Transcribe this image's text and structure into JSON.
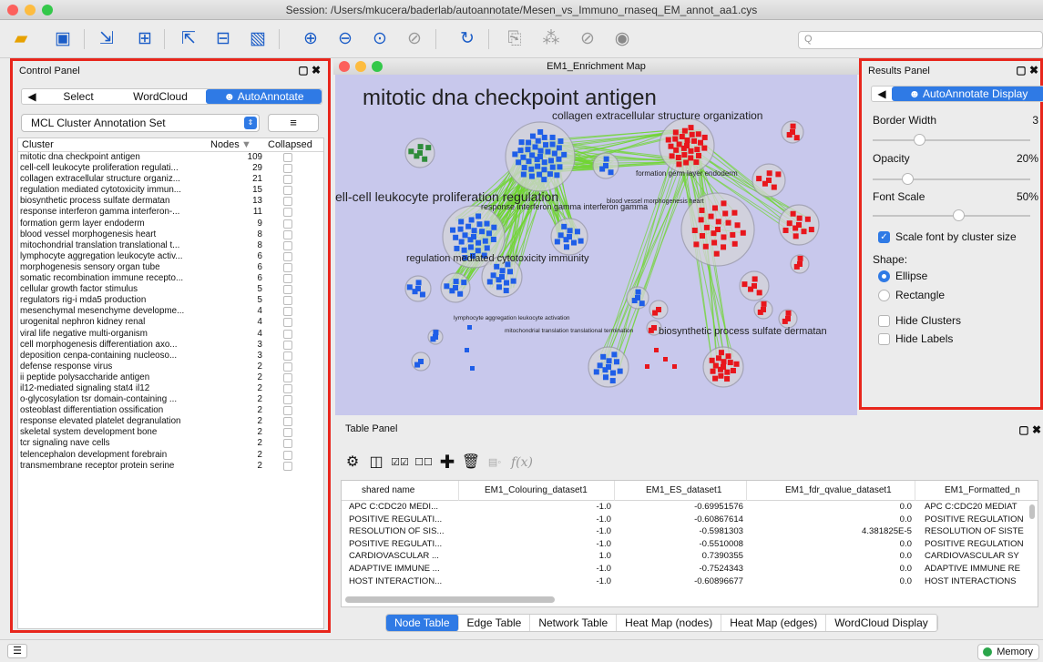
{
  "window": {
    "title": "Session: /Users/mkucera/baderlab/autoannotate/Mesen_vs_Immuno_rnaseq_EM_annot_aa1.cys"
  },
  "toolbar": {
    "search_placeholder": "Q",
    "icons": [
      "open-folder",
      "save",
      "import-network",
      "import-table",
      "export-network",
      "export-table",
      "export-image",
      "zoom-in",
      "zoom-out",
      "zoom-fit",
      "zoom-selected",
      "refresh",
      "new-network-from-selection",
      "hide",
      "show-hidden",
      "show"
    ]
  },
  "control_panel": {
    "title": "Control Panel",
    "tabs": [
      "Select",
      "WordCloud",
      "AutoAnnotate"
    ],
    "selected_tab": "AutoAnnotate",
    "annotation_set": "MCL Cluster Annotation Set",
    "menu_label": "≡",
    "columns": {
      "cluster": "Cluster",
      "nodes": "Nodes",
      "collapsed": "Collapsed"
    },
    "clusters": [
      {
        "name": "mitotic dna checkpoint antigen",
        "nodes": "109"
      },
      {
        "name": "cell-cell leukocyte proliferation regulati...",
        "nodes": "29"
      },
      {
        "name": "collagen extracellular structure organiz...",
        "nodes": "21"
      },
      {
        "name": "regulation mediated cytotoxicity immun...",
        "nodes": "15"
      },
      {
        "name": "biosynthetic process sulfate dermatan",
        "nodes": "13"
      },
      {
        "name": "response interferon gamma interferon-...",
        "nodes": "11"
      },
      {
        "name": "formation germ layer endoderm",
        "nodes": "9"
      },
      {
        "name": "blood vessel morphogenesis heart",
        "nodes": "8"
      },
      {
        "name": "mitochondrial translation translational t...",
        "nodes": "8"
      },
      {
        "name": "lymphocyte aggregation leukocyte activ...",
        "nodes": "6"
      },
      {
        "name": "morphogenesis sensory organ tube",
        "nodes": "6"
      },
      {
        "name": "somatic recombination immune recepto...",
        "nodes": "6"
      },
      {
        "name": "cellular growth factor stimulus",
        "nodes": "5"
      },
      {
        "name": "regulators rig-i mda5 production",
        "nodes": "5"
      },
      {
        "name": "mesenchymal mesenchyme developme...",
        "nodes": "4"
      },
      {
        "name": "urogenital nephron kidney renal",
        "nodes": "4"
      },
      {
        "name": "viral life negative multi-organism",
        "nodes": "4"
      },
      {
        "name": "cell morphogenesis differentiation axo...",
        "nodes": "3"
      },
      {
        "name": "deposition cenpa-containing nucleoso...",
        "nodes": "3"
      },
      {
        "name": "defense response virus",
        "nodes": "2"
      },
      {
        "name": "ii peptide polysaccharide antigen",
        "nodes": "2"
      },
      {
        "name": "il12-mediated signaling stat4 il12",
        "nodes": "2"
      },
      {
        "name": "o-glycosylation tsr domain-containing ...",
        "nodes": "2"
      },
      {
        "name": "osteoblast differentiation ossification",
        "nodes": "2"
      },
      {
        "name": "response elevated platelet degranulation",
        "nodes": "2"
      },
      {
        "name": "skeletal system development bone",
        "nodes": "2"
      },
      {
        "name": "tcr signaling nave cells",
        "nodes": "2"
      },
      {
        "name": "telencephalon development forebrain",
        "nodes": "2"
      },
      {
        "name": "transmembrane receptor protein serine",
        "nodes": "2"
      }
    ]
  },
  "network": {
    "title": "EM1_Enrichment Map",
    "labels": {
      "big": "mitotic dna checkpoint antigen",
      "collagen": "collagen extracellular structure organization",
      "cellcell": "ell-cell leukocyte proliferation regulation",
      "interferon": "response interferon gamma interferon gamma",
      "regulation": "regulation mediated cytotoxicity immunity",
      "biosynthetic": "biosynthetic process sulfate dermatan",
      "formation": "formation germ layer endoderm",
      "blood": "blood vessel morphogenesis heart",
      "lymph": "lymphocyte aggregation leukocyte activation",
      "mito": "mitochondrial translation translational termination"
    }
  },
  "results_panel": {
    "title": "Results Panel",
    "tab": "AutoAnnotate Display",
    "border_width": {
      "label": "Border Width",
      "value": "3",
      "level": 0.28
    },
    "opacity": {
      "label": "Opacity",
      "value": "20%",
      "level": 0.2
    },
    "font_scale": {
      "label": "Font Scale",
      "value": "50%",
      "level": 0.55
    },
    "scale_font": {
      "label": "Scale font by cluster size",
      "checked": true
    },
    "shape_label": "Shape:",
    "shape_options": [
      "Ellipse",
      "Rectangle"
    ],
    "shape_selected": "Ellipse",
    "hide_clusters": "Hide Clusters",
    "hide_labels": "Hide Labels"
  },
  "table_panel": {
    "title": "Table Panel",
    "fx_label": "f(x)",
    "columns": [
      "shared name",
      "EM1_Colouring_dataset1",
      "EM1_ES_dataset1",
      "EM1_fdr_qvalue_dataset1",
      "EM1_Formatted_n"
    ],
    "rows": [
      [
        "APC C:CDC20 MEDI...",
        "-1.0",
        "-0.69951576",
        "0.0",
        "APC C:CDC20 MEDIAT"
      ],
      [
        "POSITIVE REGULATI...",
        "-1.0",
        "-0.60867614",
        "0.0",
        "POSITIVE REGULATION"
      ],
      [
        "RESOLUTION OF SIS...",
        "-1.0",
        "-0.5981303",
        "4.381825E-5",
        "RESOLUTION OF SISTE"
      ],
      [
        "POSITIVE REGULATI...",
        "-1.0",
        "-0.5510008",
        "0.0",
        "POSITIVE REGULATION"
      ],
      [
        "CARDIOVASCULAR ...",
        "1.0",
        "0.7390355",
        "0.0",
        "CARDIOVASCULAR SY"
      ],
      [
        "ADAPTIVE IMMUNE ...",
        "-1.0",
        "-0.7524343",
        "0.0",
        "ADAPTIVE IMMUNE RE"
      ],
      [
        "HOST INTERACTION...",
        "-1.0",
        "-0.60896677",
        "0.0",
        "HOST INTERACTIONS"
      ]
    ],
    "tabs": [
      "Node Table",
      "Edge Table",
      "Network Table",
      "Heat Map (nodes)",
      "Heat Map (edges)",
      "WordCloud Display"
    ],
    "selected_tab": "Node Table"
  },
  "status": {
    "memory": "Memory"
  },
  "colors": {
    "accent": "#2f7ae5",
    "highlight_box": "#e8261c",
    "canvas_bg": "#c8c8ec",
    "node_blue": "#1f5ee8",
    "node_red": "#e8161c",
    "edge_green": "#6fd62f"
  }
}
